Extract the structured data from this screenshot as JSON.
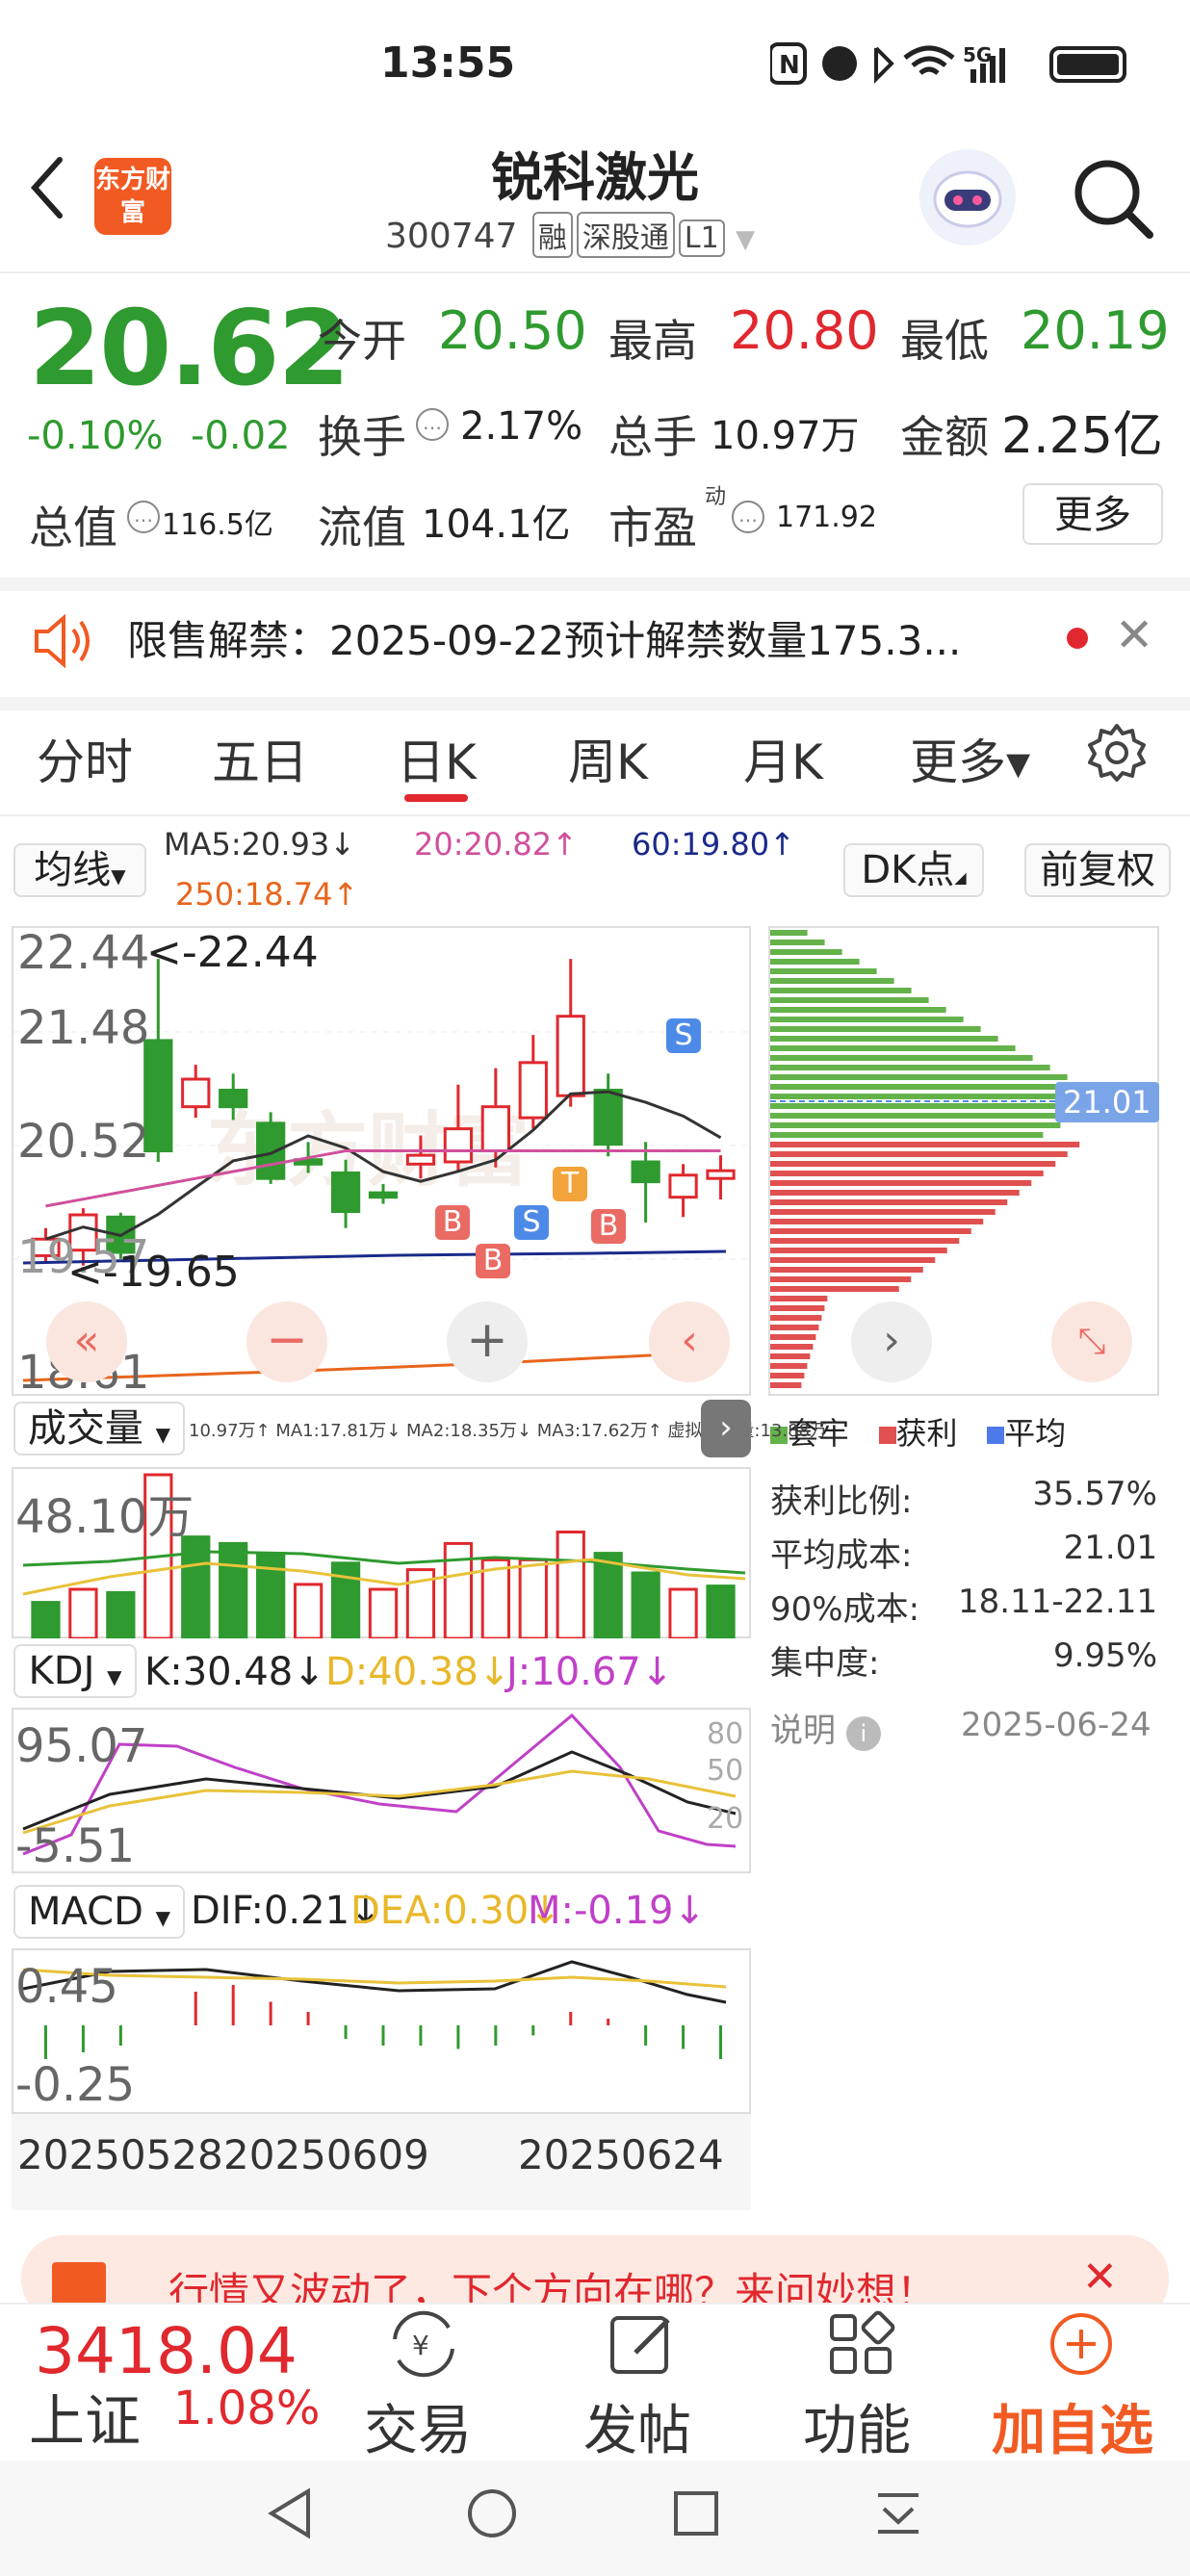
{
  "status_bar": {
    "time": "13:55",
    "network": "5G"
  },
  "header": {
    "logo_text": "东方财富",
    "stock_name": "锐科激光",
    "stock_code": "300747",
    "tags": [
      "融",
      "深股通",
      "L1"
    ]
  },
  "quote": {
    "price": "20.62",
    "change_pct": "-0.10%",
    "change": "-0.02",
    "open_label": "今开",
    "open": "20.50",
    "high_label": "最高",
    "high": "20.80",
    "low_label": "最低",
    "low": "20.19",
    "turnover_label": "换手",
    "turnover": "2.17%",
    "volume_label": "总手",
    "volume": "10.97万",
    "amount_label": "金额",
    "amount": "2.25亿",
    "mktcap_label": "总值",
    "mktcap": "116.5亿",
    "float_label": "流值",
    "float_cap": "104.1亿",
    "pe_label": "市盈",
    "pe_sup": "动",
    "pe": "171.92",
    "more_label": "更多"
  },
  "notice": {
    "text": "限售解禁：2025-09-22预计解禁数量175.3..."
  },
  "tabs": [
    {
      "label": "分时"
    },
    {
      "label": "五日"
    },
    {
      "label": "日K"
    },
    {
      "label": "周K"
    },
    {
      "label": "月K"
    },
    {
      "label": "更多▾"
    }
  ],
  "kline": {
    "indicator_select": "均线",
    "ma5": "MA5:20.93↓",
    "ma20": "20:20.82↑",
    "ma60": "60:19.80↑",
    "ma250": "250:18.74↑",
    "dk_label": "DK点",
    "adjust_label": "前复权",
    "y_top": "22.44",
    "y_mid1": "21.48",
    "y_mid2": "20.52",
    "y_low": "19.57",
    "y_bottom": "18.61",
    "max_marker": "<-22.44",
    "min_marker": "<-19.65",
    "signals": [
      "B",
      "B",
      "S",
      "T",
      "B",
      "S"
    ]
  },
  "chip_dist": {
    "avg_marker": "21.01",
    "legend": [
      "套牢",
      "获利",
      "平均"
    ],
    "stats": [
      {
        "label": "获利比例:",
        "value": "35.57%"
      },
      {
        "label": "平均成本:",
        "value": "21.01"
      },
      {
        "label": "90%成本:",
        "value": "18.11-22.11"
      },
      {
        "label": "集中度:",
        "value": "9.95%"
      }
    ],
    "note_label": "说明",
    "date": "2025-06-24"
  },
  "volume": {
    "select": "成交量",
    "line": "10.97万↑ MA1:17.81万↓ MA2:18.35万↓ MA3:17.62万↑ 虚拟成交量:13.88万",
    "y_top": "48.10万"
  },
  "kdj": {
    "select": "KDJ",
    "k": "K:30.48↓",
    "d": "D:40.38↓",
    "j": "J:10.67↓",
    "y_top": "95.07",
    "y_bottom": "-5.51",
    "levels": [
      "80",
      "50",
      "20"
    ]
  },
  "macd": {
    "select": "MACD",
    "dif": "DIF:0.21↓",
    "dea": "DEA:0.30↓",
    "m": "M:-0.19↓",
    "y_top": "0.45",
    "y_bottom": "-0.25"
  },
  "dates": {
    "d1": "20250528",
    "d2": "20250609",
    "d3": "20250624"
  },
  "banner": {
    "text": "行情又波动了，下个方向在哪？来问妙想！"
  },
  "bottom_nav": {
    "index_value": "3418.04",
    "index_name": "上证",
    "index_pct": "1.08%",
    "items": [
      {
        "label": "交易"
      },
      {
        "label": "发帖"
      },
      {
        "label": "功能"
      },
      {
        "label": "加自选"
      }
    ]
  },
  "colors": {
    "up": "#e0282e",
    "down": "#2f9a2f",
    "accent": "#f15a22"
  }
}
